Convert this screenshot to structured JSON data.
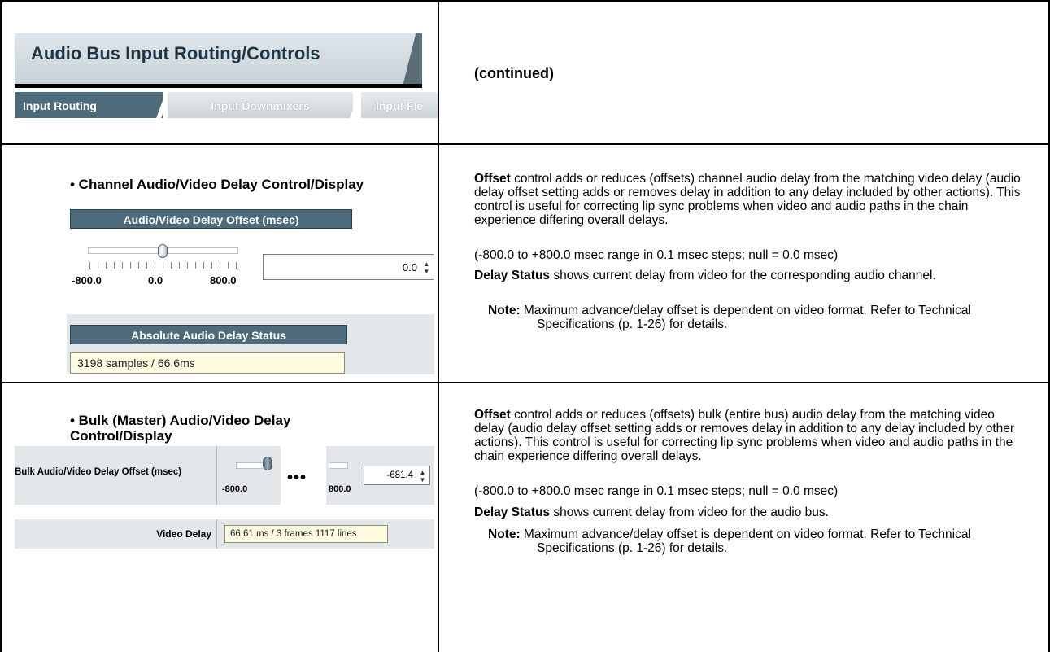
{
  "header": {
    "title": "Audio Bus Input Routing/Controls",
    "tabs": [
      "Input Routing",
      "Input Downmixers",
      "Input Fle"
    ],
    "continued": "(continued)"
  },
  "rows": [
    {
      "bullet": "• Channel Audio/Video Delay Control/Display",
      "panel": {
        "offset_title": "Audio/Video Delay Offset (msec)",
        "slider_min": "-800.0",
        "slider_mid": "0.0",
        "slider_max": "800.0",
        "offset_value": "0.0",
        "status_title": "Absolute Audio Delay Status",
        "status_value": "3198 samples / 66.6ms"
      },
      "desc": {
        "offset_term": "Offset",
        "offset_text": " control adds or reduces (offsets) channel audio delay from the matching video delay (audio delay offset setting adds or removes delay in addition to any delay included by other actions). This control is useful for correcting lip sync problems when video and audio paths in the chain experience differing overall delays.",
        "range": "(-800.0 to +800.0 msec range in 0.1 msec steps; null = 0.0 msec)",
        "status_term": "Delay Status",
        "status_text": " shows current delay from video for the corresponding audio channel.",
        "note_term": "Note:",
        "note_text": " Maximum advance/delay offset is dependent on video format. Refer to Technical Specifications (p. 1-26) for details."
      }
    },
    {
      "bullet": "• Bulk (Master) Audio/Video Delay Control/Display",
      "panel": {
        "offset_label": "Bulk Audio/Video Delay Offset (msec)",
        "slider_min": "-800.0",
        "ellipsis": "•••",
        "slider_max": "800.0",
        "offset_value": "-681.4",
        "video_delay_label": "Video Delay",
        "video_delay_value": "66.61 ms / 3 frames 1117 lines"
      },
      "desc": {
        "offset_term": "Offset",
        "offset_text": " control adds or reduces (offsets) bulk (entire bus) audio delay from the matching video delay (audio delay offset setting adds or removes delay in addition to any delay included by other actions). This control is useful for correcting lip sync problems when video and audio paths in the chain experience differing overall delays.",
        "range": "(-800.0 to +800.0 msec range in 0.1 msec steps; null = 0.0 msec)",
        "status_term": "Delay Status",
        "status_text": " shows current delay from video for the audio bus.",
        "note_term": "Note:",
        "note_text": " Maximum advance/delay offset is dependent on video format. Refer to Technical Specifications (p. 1-26) for details."
      }
    }
  ]
}
